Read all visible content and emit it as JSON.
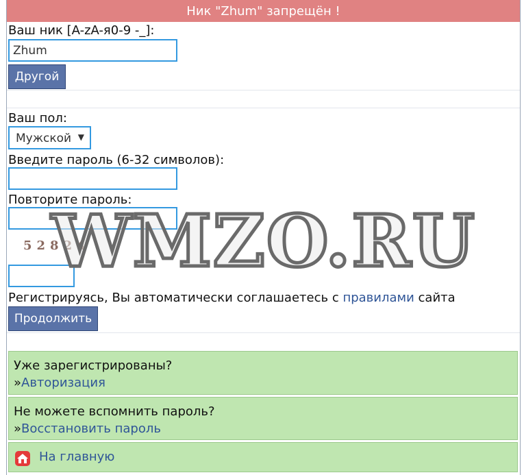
{
  "banner": {
    "text": "Ник \"Zhum\" запрещён !"
  },
  "nick": {
    "label": "Ваш ник [A-zA-я0-9 -_]:",
    "value": "Zhum",
    "other_button": "Другой"
  },
  "gender": {
    "label": "Ваш пол:",
    "selected": "Мужской"
  },
  "password": {
    "label": "Введите пароль (6-32 символов):",
    "repeat_label": "Повторите пароль:"
  },
  "captcha": {
    "text": "52824"
  },
  "agreement": {
    "prefix": "Регистрируясь, Вы автоматически соглашаетесь с",
    "link": "правилами",
    "suffix": "сайта"
  },
  "continue_button": "Продолжить",
  "login_box": {
    "title": "Уже зарегистрированы?",
    "prefix": "»",
    "link": "Авторизация"
  },
  "restore_box": {
    "title": "Не можете вспомнить пароль?",
    "prefix": "»",
    "link": "Восстановить пароль"
  },
  "home": {
    "link": "На главную"
  },
  "watermark": {
    "text": "WMZO.RU"
  },
  "colors": {
    "banner": "#e08282",
    "button": "#5a73a8",
    "input_border": "#3399e0",
    "green_box": "#bfe6b0",
    "link": "#2f5597"
  },
  "icons": {
    "home": "home-icon",
    "dropdown": "chevron-down-icon"
  }
}
